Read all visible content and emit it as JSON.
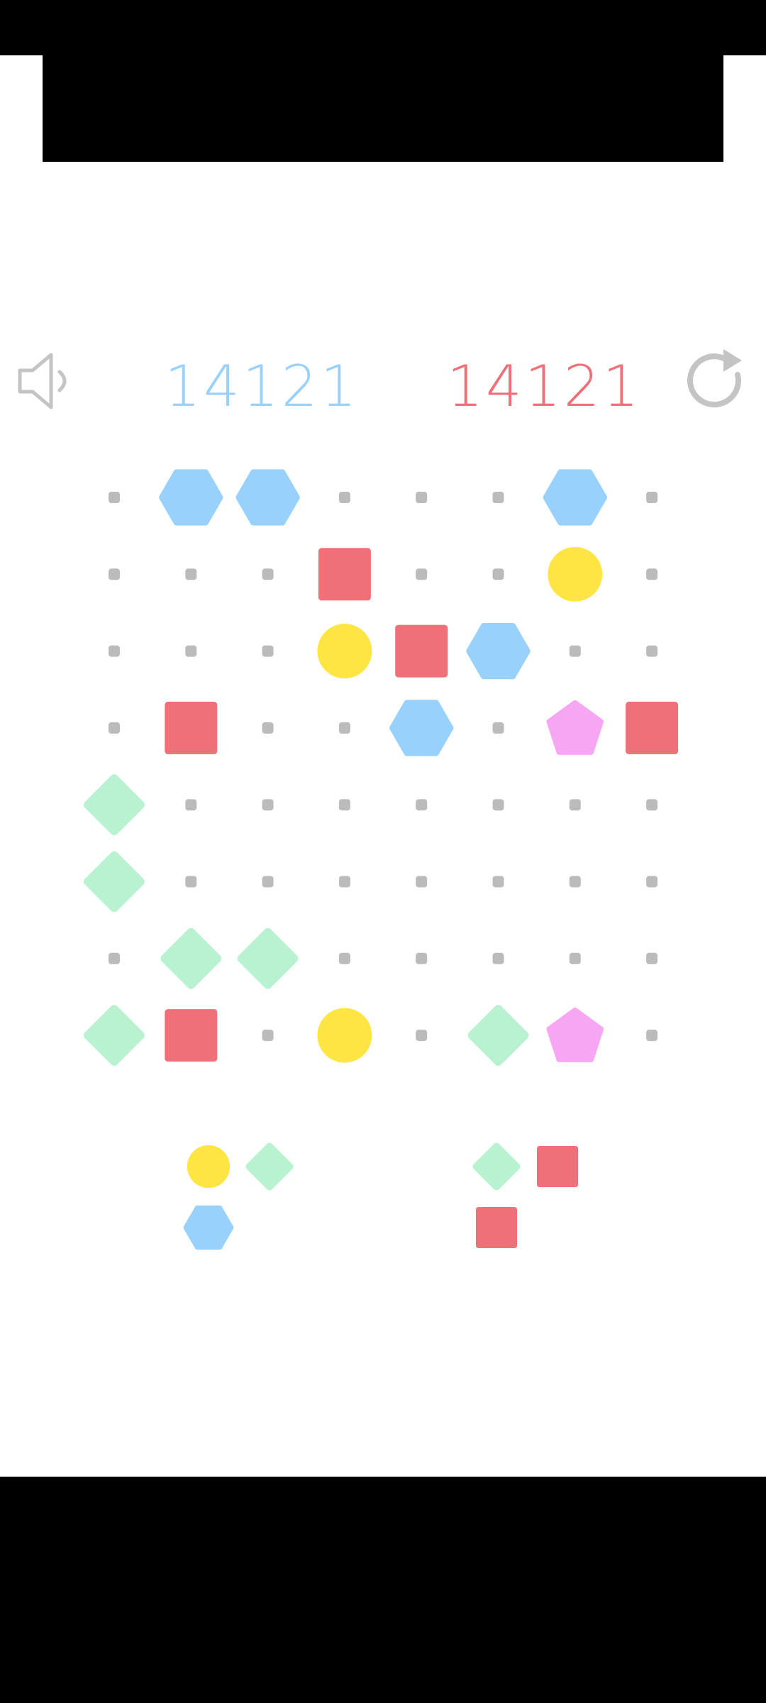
{
  "scores": {
    "blue": "14121",
    "red": "14121"
  },
  "colors": {
    "blue": "#99d1fd",
    "red": "#f07079",
    "yellow": "#ffe544",
    "green": "#b8f2d0",
    "pink": "#f6a6f2",
    "dot": "#bbbbbb",
    "icon": "#c4c4c4"
  },
  "icons": {
    "sound": "speaker-icon",
    "restart": "restart-icon"
  },
  "board": {
    "rows": 8,
    "cols": 8,
    "cells": [
      [
        "dot",
        "hexagon",
        "hexagon",
        "dot",
        "dot",
        "dot",
        "hexagon",
        "dot"
      ],
      [
        "dot",
        "dot",
        "dot",
        "square",
        "dot",
        "dot",
        "circle",
        "dot"
      ],
      [
        "dot",
        "dot",
        "dot",
        "circle",
        "square",
        "hexagon",
        "dot",
        "dot"
      ],
      [
        "dot",
        "square",
        "dot",
        "dot",
        "hexagon",
        "dot",
        "pentagon",
        "square"
      ],
      [
        "diamond",
        "dot",
        "dot",
        "dot",
        "dot",
        "dot",
        "dot",
        "dot"
      ],
      [
        "diamond",
        "dot",
        "dot",
        "dot",
        "dot",
        "dot",
        "dot",
        "dot"
      ],
      [
        "dot",
        "diamond",
        "diamond",
        "dot",
        "dot",
        "dot",
        "dot",
        "dot"
      ],
      [
        "diamond",
        "square",
        "dot",
        "circle",
        "dot",
        "diamond",
        "pentagon",
        "dot"
      ]
    ]
  },
  "pieces": {
    "left": [
      [
        "circle",
        "diamond"
      ],
      [
        "hexagon",
        "empty"
      ]
    ],
    "right": [
      [
        "diamond",
        "square"
      ],
      [
        "square",
        "empty"
      ]
    ]
  }
}
